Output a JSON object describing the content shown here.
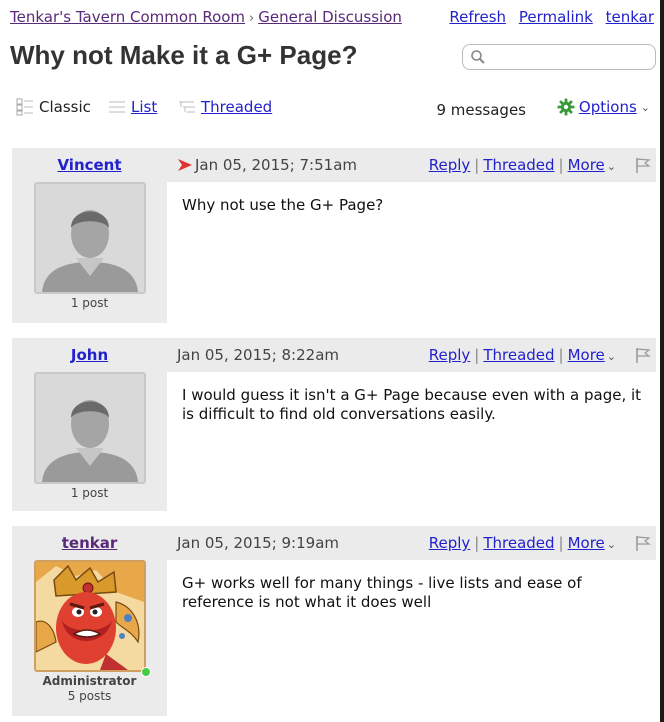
{
  "breadcrumb": {
    "forum": "Tenkar's Tavern Common Room",
    "separator": "›",
    "section": "General Discussion"
  },
  "toplinks": {
    "refresh": "Refresh",
    "permalink": "Permalink",
    "user": "tenkar"
  },
  "page_title": "Why not Make it a G+ Page?",
  "search": {
    "placeholder": "",
    "value": ""
  },
  "views": {
    "classic": "Classic",
    "list": "List",
    "threaded": "Threaded"
  },
  "message_count": "9 messages",
  "options_label": "Options",
  "colors": {
    "link": "#2222cc",
    "visited": "#5a2a7a",
    "panel": "#ebebeb",
    "accent_arrow": "#dd3333",
    "online": "#44cc44"
  },
  "posts": [
    {
      "author": "Vincent",
      "post_count": "1 post",
      "role": "",
      "date": "Jan 05, 2015; 7:51am",
      "reply": "Reply",
      "threaded": "Threaded",
      "more": "More",
      "body": "Why not use the G+ Page?",
      "avatar": "default-avatar"
    },
    {
      "author": "John",
      "post_count": "1 post",
      "role": "",
      "date": "Jan 05, 2015; 8:22am",
      "reply": "Reply",
      "threaded": "Threaded",
      "more": "More",
      "body": "I would guess it isn't a G+ Page because even with a page, it is difficult to find old conversations easily.",
      "avatar": "default-avatar"
    },
    {
      "author": "tenkar",
      "post_count": "5 posts",
      "role": "Administrator",
      "date": "Jan 05, 2015; 9:19am",
      "reply": "Reply",
      "threaded": "Threaded",
      "more": "More",
      "body": "G+ works well for many things - live lists and ease of reference is not what it does well",
      "avatar": "dwarf-avatar"
    }
  ]
}
